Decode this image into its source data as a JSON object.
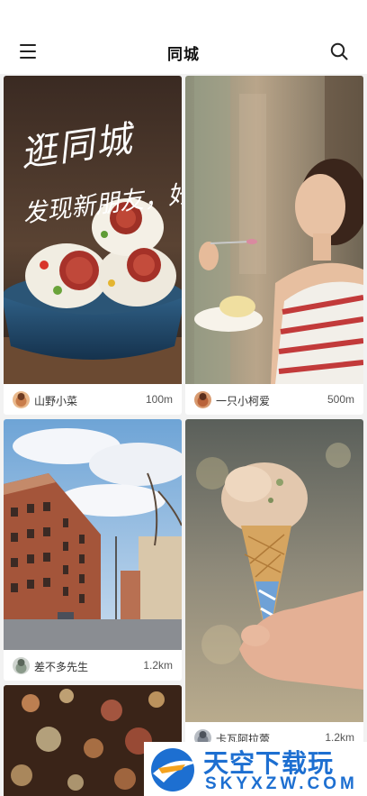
{
  "header": {
    "title": "同城",
    "menu_icon": "hamburger-menu-icon",
    "search_icon": "search-icon"
  },
  "banner": {
    "line1": "逛同城",
    "line2": "发现新朋友，好去处"
  },
  "cards": [
    {
      "author": "山野小菜",
      "distance": "100m"
    },
    {
      "author": "一只小柯爱",
      "distance": "500m"
    },
    {
      "author": "差不多先生",
      "distance": "1.2km"
    },
    {
      "author": "卡瓦阿拉蕾",
      "distance": "1.2km"
    }
  ],
  "watermark": {
    "brand": "天空下载玩",
    "url": "SKYXZW.COM"
  }
}
